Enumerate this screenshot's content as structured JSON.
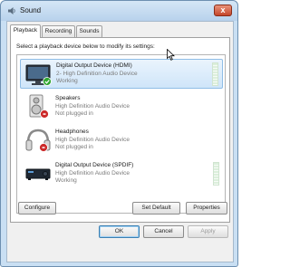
{
  "window": {
    "title": "Sound",
    "close_label": "x"
  },
  "tabs": [
    {
      "label": "Playback",
      "active": true
    },
    {
      "label": "Recording",
      "active": false
    },
    {
      "label": "Sounds",
      "active": false
    }
  ],
  "panel": {
    "instruction": "Select a playback device below to modify its settings:"
  },
  "devices": [
    {
      "name": "Digital Output Device (HDMI)",
      "line2": "2- High Definition Audio Device",
      "status": "Working",
      "icon": "monitor-icon",
      "badge": "default-check-badge",
      "selected": true
    },
    {
      "name": "Speakers",
      "line2": "High Definition Audio Device",
      "status": "Not plugged in",
      "icon": "speaker-icon",
      "badge": "unplugged-badge",
      "selected": false
    },
    {
      "name": "Headphones",
      "line2": "High Definition Audio Device",
      "status": "Not plugged in",
      "icon": "headphones-icon",
      "badge": "unplugged-badge",
      "selected": false
    },
    {
      "name": "Digital Output Device (SPDIF)",
      "line2": "High Definition Audio Device",
      "status": "Working",
      "icon": "digital-receiver-icon",
      "badge": "",
      "selected": false
    }
  ],
  "buttons": {
    "configure": "Configure",
    "set_default": "Set Default",
    "properties": "Properties",
    "ok": "OK",
    "cancel": "Cancel",
    "apply": "Apply"
  },
  "colors": {
    "selection": "#cfe5f9",
    "accent": "#3c7fb1",
    "window_frame": "#c9dff3"
  }
}
